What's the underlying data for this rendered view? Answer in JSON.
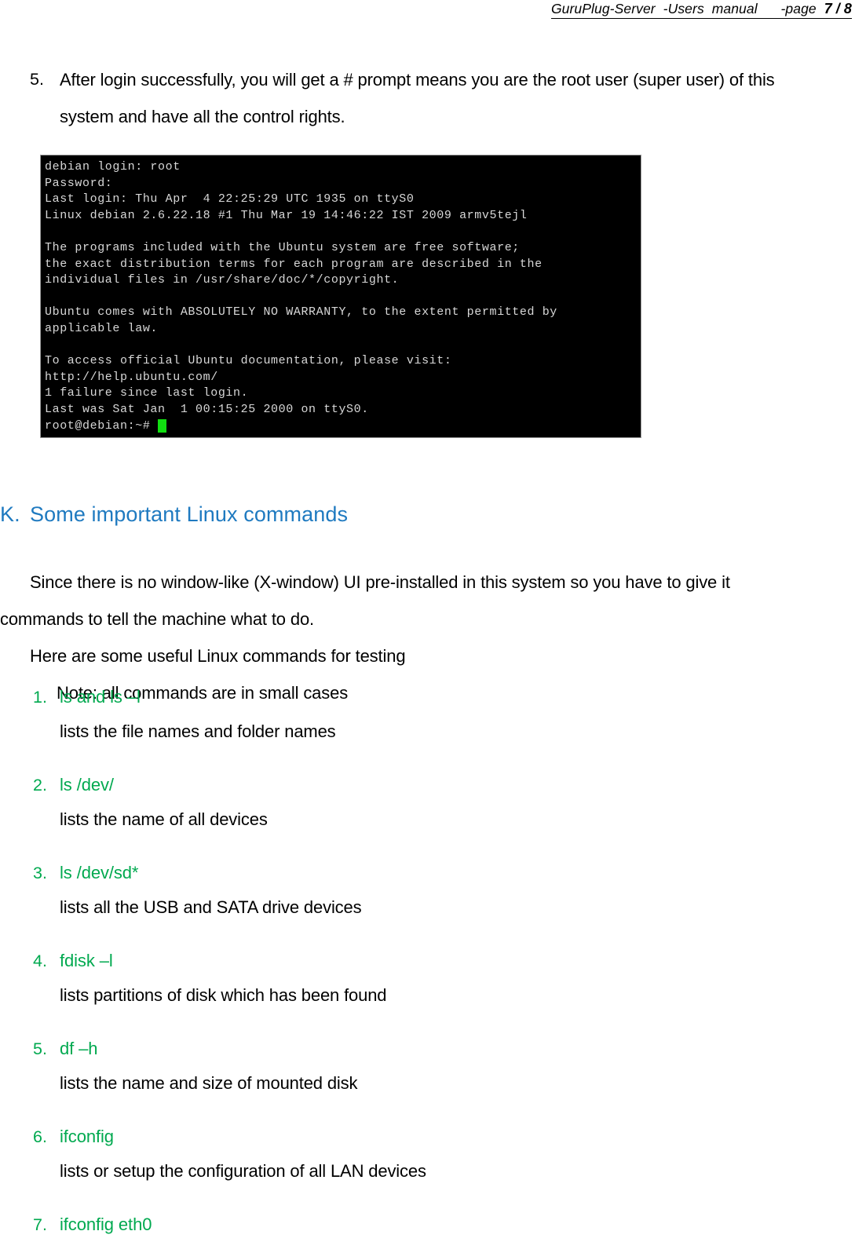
{
  "header": {
    "manual_title": "GuruPlug-Server  -Users  manual",
    "page_label": "-page",
    "page_current": "7",
    "page_separator": "/",
    "page_total": "8"
  },
  "step": {
    "number": "5.",
    "text": "After login successfully, you will get a # prompt means you are the root user (super user) of this system and have all the control rights."
  },
  "terminal": {
    "lines": [
      "debian login: root",
      "Password:",
      "Last login: Thu Apr  4 22:25:29 UTC 1935 on ttyS0",
      "Linux debian 2.6.22.18 #1 Thu Mar 19 14:46:22 IST 2009 armv5tejl",
      "",
      "The programs included with the Ubuntu system are free software;",
      "the exact distribution terms for each program are described in the",
      "individual files in /usr/share/doc/*/copyright.",
      "",
      "Ubuntu comes with ABSOLUTELY NO WARRANTY, to the extent permitted by",
      "applicable law.",
      "",
      "To access official Ubuntu documentation, please visit:",
      "http://help.ubuntu.com/",
      "1 failure since last login.",
      "Last was Sat Jan  1 00:15:25 2000 on ttyS0."
    ],
    "prompt": "root@debian:~#",
    "cursor_color": "#11df11",
    "background_color": "#000000",
    "text_color": "#d8d8d8"
  },
  "section": {
    "letter": "K.",
    "title": "Some important Linux commands",
    "color": "#1f7ac0"
  },
  "intro": {
    "para1": "Since there is no window-like (X-window) UI pre-installed in this system so you have to give it commands to tell the machine what to do.",
    "para2": "Here are some useful Linux commands for testing",
    "para3": "Note: all commands are in small cases"
  },
  "commands": {
    "accent_color": "#00a94f",
    "items": [
      {
        "number": "1.",
        "name": "ls and ls –l",
        "description": "lists the file names and folder names"
      },
      {
        "number": "2.",
        "name": "ls /dev/",
        "description": "lists the name of all devices"
      },
      {
        "number": "3.",
        "name": "ls /dev/sd*",
        "description": "lists all the USB and SATA drive devices"
      },
      {
        "number": "4.",
        "name": "fdisk –l",
        "description": "lists partitions of disk which has been found"
      },
      {
        "number": "5.",
        "name": "df –h",
        "description": "lists the name and size of mounted disk"
      },
      {
        "number": "6.",
        "name": "ifconfig",
        "description": "lists or setup the configuration of all LAN devices"
      },
      {
        "number": "7.",
        "name": "ifconfig eth0",
        "description": ""
      }
    ]
  }
}
